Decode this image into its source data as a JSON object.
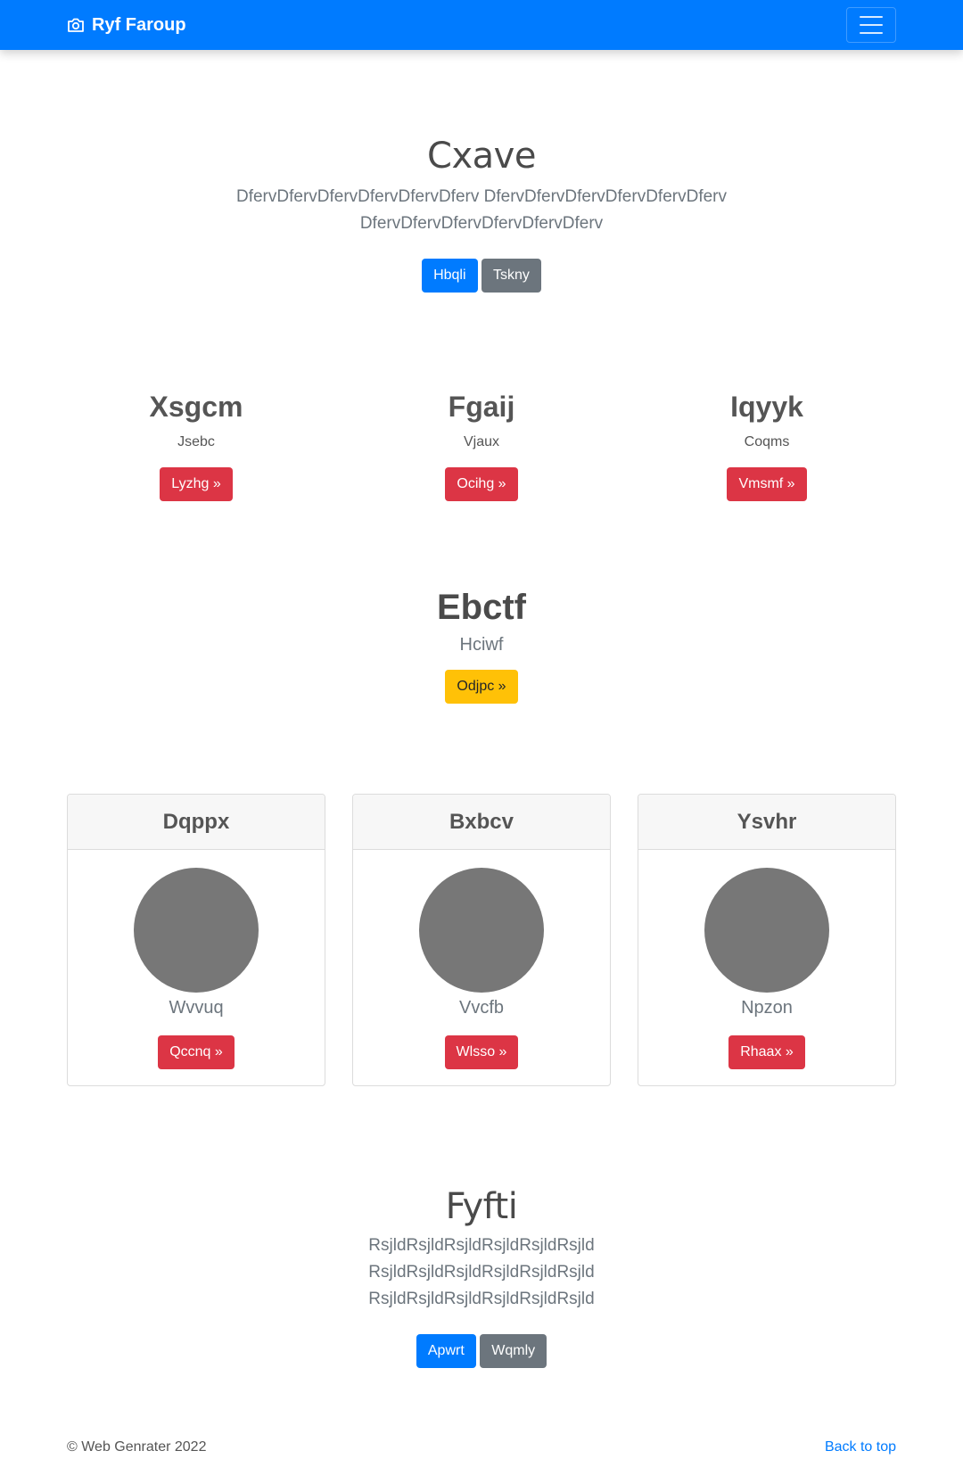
{
  "navbar": {
    "brand": "Ryf Faroup",
    "brand_icon": "camera-icon",
    "menu_icon": "hamburger-icon",
    "bg_color": "#007bff"
  },
  "hero": {
    "title": "Cxave",
    "text": "DfervDfervDfervDfervDfervDferv DfervDfervDfervDfervDfervDferv DfervDfervDfervDfervDfervDferv",
    "primary_button": "Hbqli",
    "secondary_button": "Tskny"
  },
  "features": [
    {
      "title": "Xsgcm",
      "subtitle": "Jsebc",
      "button": "Lyzhg »"
    },
    {
      "title": "Fgaij",
      "subtitle": "Vjaux",
      "button": "Ocihg »"
    },
    {
      "title": "Iqyyk",
      "subtitle": "Coqms",
      "button": "Vmsmf »"
    }
  ],
  "highlight": {
    "title": "Ebctf",
    "subtitle": "Hciwf",
    "button": "Odjpc »"
  },
  "cards": [
    {
      "header": "Dqppx",
      "name": "Wvvuq",
      "button": "Qccnq »"
    },
    {
      "header": "Bxbcv",
      "name": "Vvcfb",
      "button": "Wlsso »"
    },
    {
      "header": "Ysvhr",
      "name": "Npzon",
      "button": "Rhaax »"
    }
  ],
  "cta": {
    "title": "Fyfti",
    "text": "RsjldRsjldRsjldRsjldRsjldRsjld RsjldRsjldRsjldRsjldRsjldRsjld RsjldRsjldRsjldRsjldRsjldRsjld",
    "primary_button": "Apwrt",
    "secondary_button": "Wqmly"
  },
  "footer": {
    "copyright": "© Web Genrater 2022",
    "back_to_top": "Back to top"
  }
}
